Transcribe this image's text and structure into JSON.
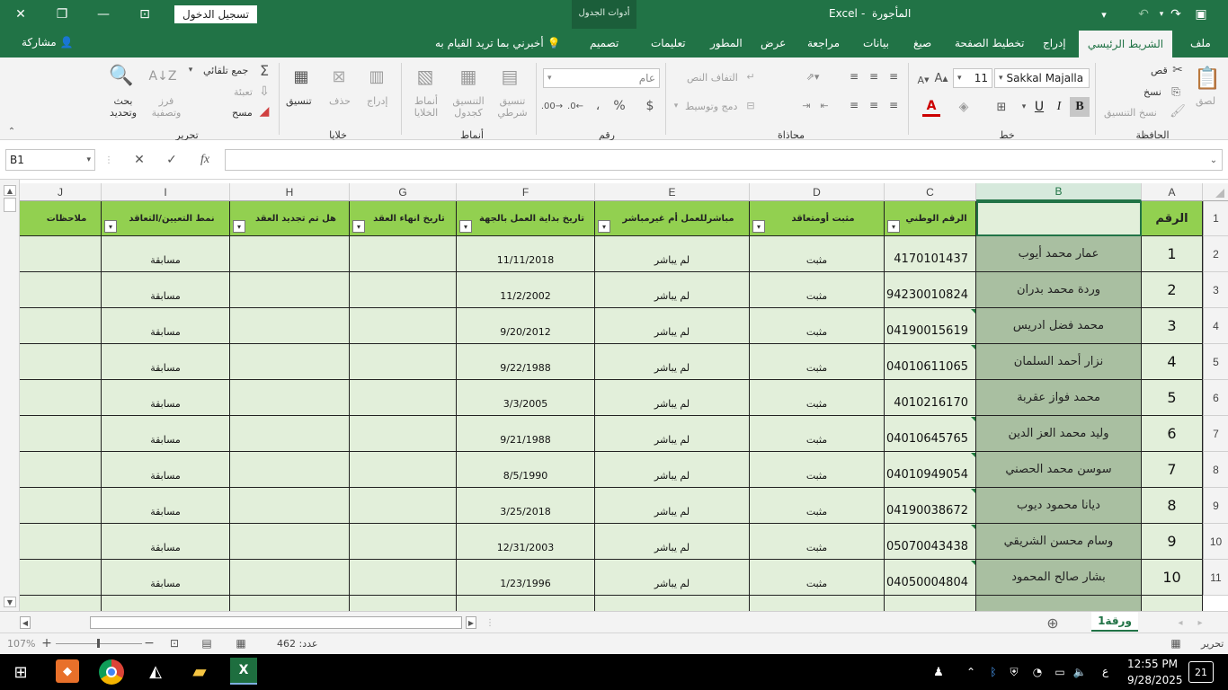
{
  "title": {
    "app": "Excel",
    "doc": "المأجورة",
    "sep": "-",
    "context_tools": "أدوات الجدول",
    "signin": "تسجيل الدخول"
  },
  "tabs": [
    "ملف",
    "الشريط الرئيسي",
    "إدراج",
    "تخطيط الصفحة",
    "صيغ",
    "بيانات",
    "مراجعة",
    "عرض",
    "المطور",
    "تعليمات",
    "تصميم"
  ],
  "tellme": "أخبرني بما تريد القيام به",
  "share": "مشاركة",
  "ribbon": {
    "clipboard": {
      "group": "الحافظة",
      "paste": "لصق",
      "cut": "قص",
      "copy": "نسخ",
      "format_painter": "نسخ التنسيق"
    },
    "font": {
      "group": "خط",
      "name": "Sakkal Majalla",
      "size": "11"
    },
    "alignment": {
      "group": "محاذاة",
      "wrap": "التفاف النص",
      "merge": "دمج وتوسيط"
    },
    "number": {
      "group": "رقم",
      "format": "عام"
    },
    "styles": {
      "group": "أنماط",
      "conditional": "تنسيق شرطي",
      "as_table": "التنسيق كجدول",
      "cell_styles": "أنماط الخلايا"
    },
    "cells": {
      "group": "خلايا",
      "insert": "إدراج",
      "delete": "حذف",
      "format": "تنسيق"
    },
    "editing": {
      "group": "تحرير",
      "autosum": "جمع تلقائي",
      "fill": "تعبئة",
      "clear": "مسح",
      "sort": "فرز وتصفية",
      "find": "بحث وتحديد"
    }
  },
  "formula_bar": {
    "name_box": "B1",
    "fx": "fx",
    "value": ""
  },
  "columns": [
    "A",
    "B",
    "C",
    "D",
    "E",
    "F",
    "G",
    "H",
    "I",
    "J"
  ],
  "row_numbers": [
    "1",
    "2",
    "3",
    "4",
    "5",
    "6",
    "7",
    "8",
    "9",
    "10",
    "11"
  ],
  "headers": {
    "A": "الرقم",
    "B": "",
    "C": "الرقم الوطني",
    "D": "مثبت أومتعاقد",
    "E": "مباشرللعمل أم غيرمباشر",
    "F": "تاريخ بداية العمل بالجهة",
    "G": "تاريخ انهاء العقد",
    "H": "هل تم تجديد العقد",
    "I": "نمط التعيين/التعاقد",
    "J": "ملاحظات"
  },
  "rows": [
    {
      "A": "1",
      "B": "عمار محمد أيوب",
      "C": "4170101437",
      "D": "مثبت",
      "E": "لم يباشر",
      "F": "11/11/2018",
      "G": "",
      "H": "",
      "I": "مسابقة",
      "J": ""
    },
    {
      "A": "2",
      "B": "وردة محمد بدران",
      "C": "94230010824",
      "D": "مثبت",
      "E": "لم يباشر",
      "F": "11/2/2002",
      "G": "",
      "H": "",
      "I": "مسابقة",
      "J": ""
    },
    {
      "A": "3",
      "B": "محمد فضل ادريس",
      "C": "04190015619",
      "D": "مثبت",
      "E": "لم يباشر",
      "F": "9/20/2012",
      "G": "",
      "H": "",
      "I": "مسابقة",
      "J": ""
    },
    {
      "A": "4",
      "B": "نزار أحمد السلمان",
      "C": "04010611065",
      "D": "مثبت",
      "E": "لم يباشر",
      "F": "9/22/1988",
      "G": "",
      "H": "",
      "I": "مسابقة",
      "J": ""
    },
    {
      "A": "5",
      "B": "محمد فواز عقربة",
      "C": "4010216170",
      "D": "مثبت",
      "E": "لم يباشر",
      "F": "3/3/2005",
      "G": "",
      "H": "",
      "I": "مسابقة",
      "J": ""
    },
    {
      "A": "6",
      "B": "وليد محمد العز الدين",
      "C": "04010645765",
      "D": "مثبت",
      "E": "لم يباشر",
      "F": "9/21/1988",
      "G": "",
      "H": "",
      "I": "مسابقة",
      "J": ""
    },
    {
      "A": "7",
      "B": "سوسن محمد الحصني",
      "C": "04010949054",
      "D": "مثبت",
      "E": "لم يباشر",
      "F": "8/5/1990",
      "G": "",
      "H": "",
      "I": "مسابقة",
      "J": ""
    },
    {
      "A": "8",
      "B": "ديانا محمود ديوب",
      "C": "04190038672",
      "D": "مثبت",
      "E": "لم يباشر",
      "F": "3/25/2018",
      "G": "",
      "H": "",
      "I": "مسابقة",
      "J": ""
    },
    {
      "A": "9",
      "B": "وسام محسن الشريقي",
      "C": "05070043438",
      "D": "مثبت",
      "E": "لم يباشر",
      "F": "12/31/2003",
      "G": "",
      "H": "",
      "I": "مسابقة",
      "J": ""
    },
    {
      "A": "10",
      "B": "بشار صالح المحمود",
      "C": "04050004804",
      "D": "مثبت",
      "E": "لم يباشر",
      "F": "1/23/1996",
      "G": "",
      "H": "",
      "I": "مسابقة",
      "J": ""
    }
  ],
  "sheet_tab": "ورقة1",
  "status": {
    "mode": "تحرير",
    "count": "عدد: 462",
    "zoom": "107%"
  },
  "taskbar": {
    "time": "12:55 PM",
    "date": "9/28/2025",
    "lang": "ع",
    "notif": "21"
  },
  "colors": {
    "excel_green": "#217346",
    "header_fill": "#92d050",
    "data_fill": "#e2efda",
    "name_fill": "#a9bfa1"
  }
}
